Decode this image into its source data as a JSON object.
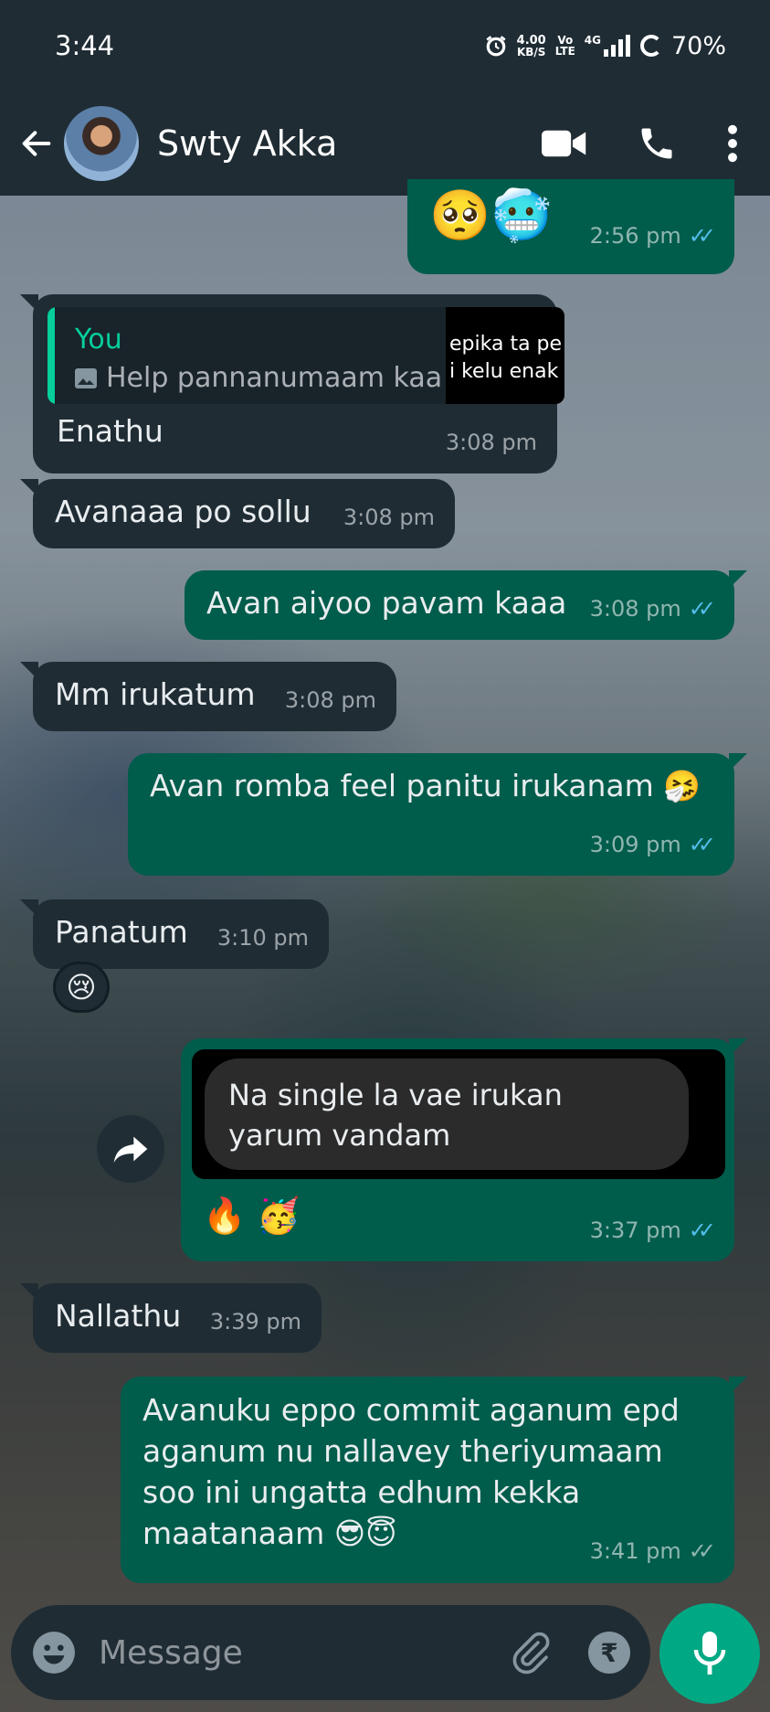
{
  "status_bar": {
    "time": "3:44",
    "speed_value": "4.00",
    "speed_unit": "KB/S",
    "volte_top": "Vo",
    "volte_bottom": "LTE",
    "network": "4G",
    "battery": "70%"
  },
  "header": {
    "contact_name": "Swty Akka"
  },
  "messages": [
    {
      "id": "m0",
      "direction": "out",
      "text": "🥺🥶",
      "time": "2:56 pm",
      "status": "read"
    },
    {
      "id": "m1",
      "direction": "in",
      "quote": {
        "author": "You",
        "text": "Help pannanumaam kaa",
        "thumb_line1": "epika ta pe",
        "thumb_line2": "i kelu enak"
      },
      "text": "Enathu",
      "time": "3:08 pm"
    },
    {
      "id": "m2",
      "direction": "in",
      "text": "Avanaaa po sollu",
      "time": "3:08 pm"
    },
    {
      "id": "m3",
      "direction": "out",
      "text": "Avan aiyoo pavam kaaa",
      "time": "3:08 pm",
      "status": "read"
    },
    {
      "id": "m4",
      "direction": "in",
      "text": "Mm irukatum",
      "time": "3:08 pm"
    },
    {
      "id": "m5",
      "direction": "out",
      "text": "Avan romba feel panitu irukanam 🤧",
      "time": "3:09 pm",
      "status": "read"
    },
    {
      "id": "m6",
      "direction": "in",
      "text": "Panatum",
      "time": "3:10 pm",
      "reaction": "😢"
    },
    {
      "id": "m7",
      "direction": "out",
      "forwarded_text": "Na single la vae irukan yarum vandam",
      "text": "🔥 🥳",
      "time": "3:37 pm",
      "status": "read"
    },
    {
      "id": "m8",
      "direction": "in",
      "text": "Nallathu",
      "time": "3:39 pm"
    },
    {
      "id": "m9",
      "direction": "out",
      "text": "Avanuku eppo commit aganum epd aganum nu nallavey theriyumaam soo ini ungatta edhum kekka maatanaam 😎😇",
      "time": "3:41 pm",
      "status": "delivered"
    }
  ],
  "composer": {
    "placeholder": "Message",
    "value": ""
  },
  "colors": {
    "header_bg": "#1f2c34",
    "incoming_bubble": "#1f2c34",
    "outgoing_bubble": "#005c4b",
    "accent": "#00a884",
    "read_ticks": "#53bdeb"
  }
}
